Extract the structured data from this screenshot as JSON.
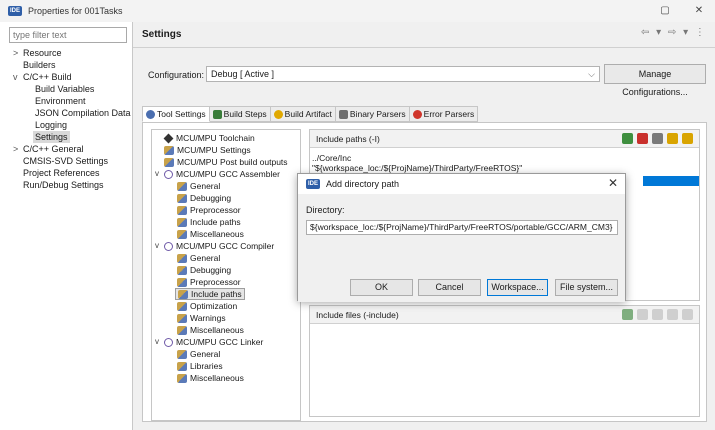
{
  "window": {
    "badge": "IDE",
    "title": "Properties for 001Tasks",
    "minimize": "▢",
    "close": "✕"
  },
  "left": {
    "filter_placeholder": "type filter text",
    "items": [
      {
        "label": "Resource",
        "chev": ">"
      },
      {
        "label": "Builders",
        "chev": ""
      },
      {
        "label": "C/C++ Build",
        "chev": "v"
      },
      {
        "label": "Build Variables",
        "chev": ""
      },
      {
        "label": "Environment",
        "chev": ""
      },
      {
        "label": "JSON Compilation Data",
        "chev": ""
      },
      {
        "label": "Logging",
        "chev": ""
      },
      {
        "label": "Settings",
        "chev": ""
      },
      {
        "label": "C/C++ General",
        "chev": ">"
      },
      {
        "label": "CMSIS-SVD Settings",
        "chev": ""
      },
      {
        "label": "Project References",
        "chev": ""
      },
      {
        "label": "Run/Debug Settings",
        "chev": ""
      }
    ]
  },
  "right": {
    "title": "Settings",
    "nav": "⇦ ▾ ⇨ ▾ ⋮",
    "config_label": "Configuration:",
    "config_value": "Debug  [ Active ]",
    "manage_button": "Manage Configurations...",
    "tabs": [
      {
        "label": "Tool Settings",
        "color": "#4b6fb0"
      },
      {
        "label": "Build Steps",
        "color": "#3a7d3a"
      },
      {
        "label": "Build Artifact",
        "color": "#e0a800"
      },
      {
        "label": "Binary Parsers",
        "color": "#6e6e6e"
      },
      {
        "label": "Error Parsers",
        "color": "#d0352b"
      }
    ]
  },
  "tree": [
    {
      "label": "MCU/MPU Toolchain",
      "chev": "",
      "icon": "tool"
    },
    {
      "label": "MCU/MPU Settings",
      "chev": "",
      "icon": "set"
    },
    {
      "label": "MCU/MPU Post build outputs",
      "chev": "",
      "icon": "set"
    },
    {
      "label": "MCU/MPU GCC Assembler",
      "chev": "v",
      "icon": "gear"
    },
    {
      "label": "General",
      "chev": "",
      "icon": "set"
    },
    {
      "label": "Debugging",
      "chev": "",
      "icon": "set"
    },
    {
      "label": "Preprocessor",
      "chev": "",
      "icon": "set"
    },
    {
      "label": "Include paths",
      "chev": "",
      "icon": "set"
    },
    {
      "label": "Miscellaneous",
      "chev": "",
      "icon": "set"
    },
    {
      "label": "MCU/MPU GCC Compiler",
      "chev": "v",
      "icon": "gear"
    },
    {
      "label": "General",
      "chev": "",
      "icon": "set"
    },
    {
      "label": "Debugging",
      "chev": "",
      "icon": "set"
    },
    {
      "label": "Preprocessor",
      "chev": "",
      "icon": "set"
    },
    {
      "label": "Include paths",
      "chev": "",
      "icon": "set"
    },
    {
      "label": "Optimization",
      "chev": "",
      "icon": "set"
    },
    {
      "label": "Warnings",
      "chev": "",
      "icon": "set"
    },
    {
      "label": "Miscellaneous",
      "chev": "",
      "icon": "set"
    },
    {
      "label": "MCU/MPU GCC Linker",
      "chev": "v",
      "icon": "gear"
    },
    {
      "label": "General",
      "chev": "",
      "icon": "set"
    },
    {
      "label": "Libraries",
      "chev": "",
      "icon": "set"
    },
    {
      "label": "Miscellaneous",
      "chev": "",
      "icon": "set"
    }
  ],
  "include_paths": {
    "title": "Include paths (-I)",
    "rows": [
      "../Core/Inc",
      "\"${workspace_loc:/${ProjName}/ThirdParty/FreeRTOS}\""
    ]
  },
  "include_files": {
    "title": "Include files (-include)"
  },
  "dialog": {
    "badge": "IDE",
    "title": "Add directory path",
    "label": "Directory:",
    "value": "${workspace_loc:/${ProjName}/ThirdParty/FreeRTOS/portable/GCC/ARM_CM3}",
    "ok": "OK",
    "cancel": "Cancel",
    "workspace": "Workspace...",
    "filesystem": "File system..."
  }
}
